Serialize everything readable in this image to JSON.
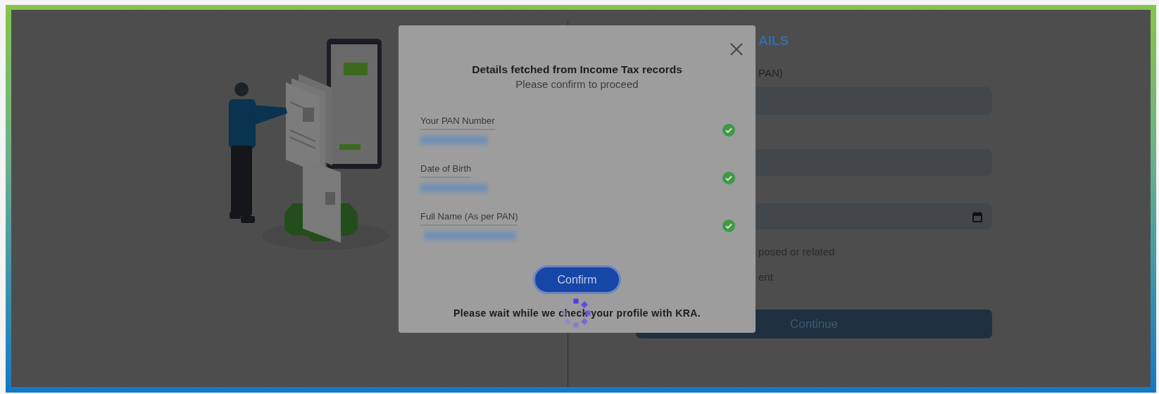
{
  "background_form": {
    "heading": "AILS",
    "field_label": "PAN)",
    "inputs": [
      {
        "kind": "text"
      },
      {
        "kind": "text"
      },
      {
        "kind": "date"
      }
    ],
    "option_texts": [
      "posed or related",
      "ent"
    ],
    "continue_button": "Continue"
  },
  "modal": {
    "title": "Details fetched from Income Tax records",
    "subtitle": "Please confirm to proceed",
    "fields": [
      {
        "label": "Your PAN Number",
        "verified": true
      },
      {
        "label": "Date of Birth",
        "verified": true
      },
      {
        "label": "Full Name (As per PAN)",
        "verified": true
      }
    ],
    "confirm_button": "Confirm",
    "status_message": "Please wait while we check your profile with KRA.",
    "loading": true
  }
}
